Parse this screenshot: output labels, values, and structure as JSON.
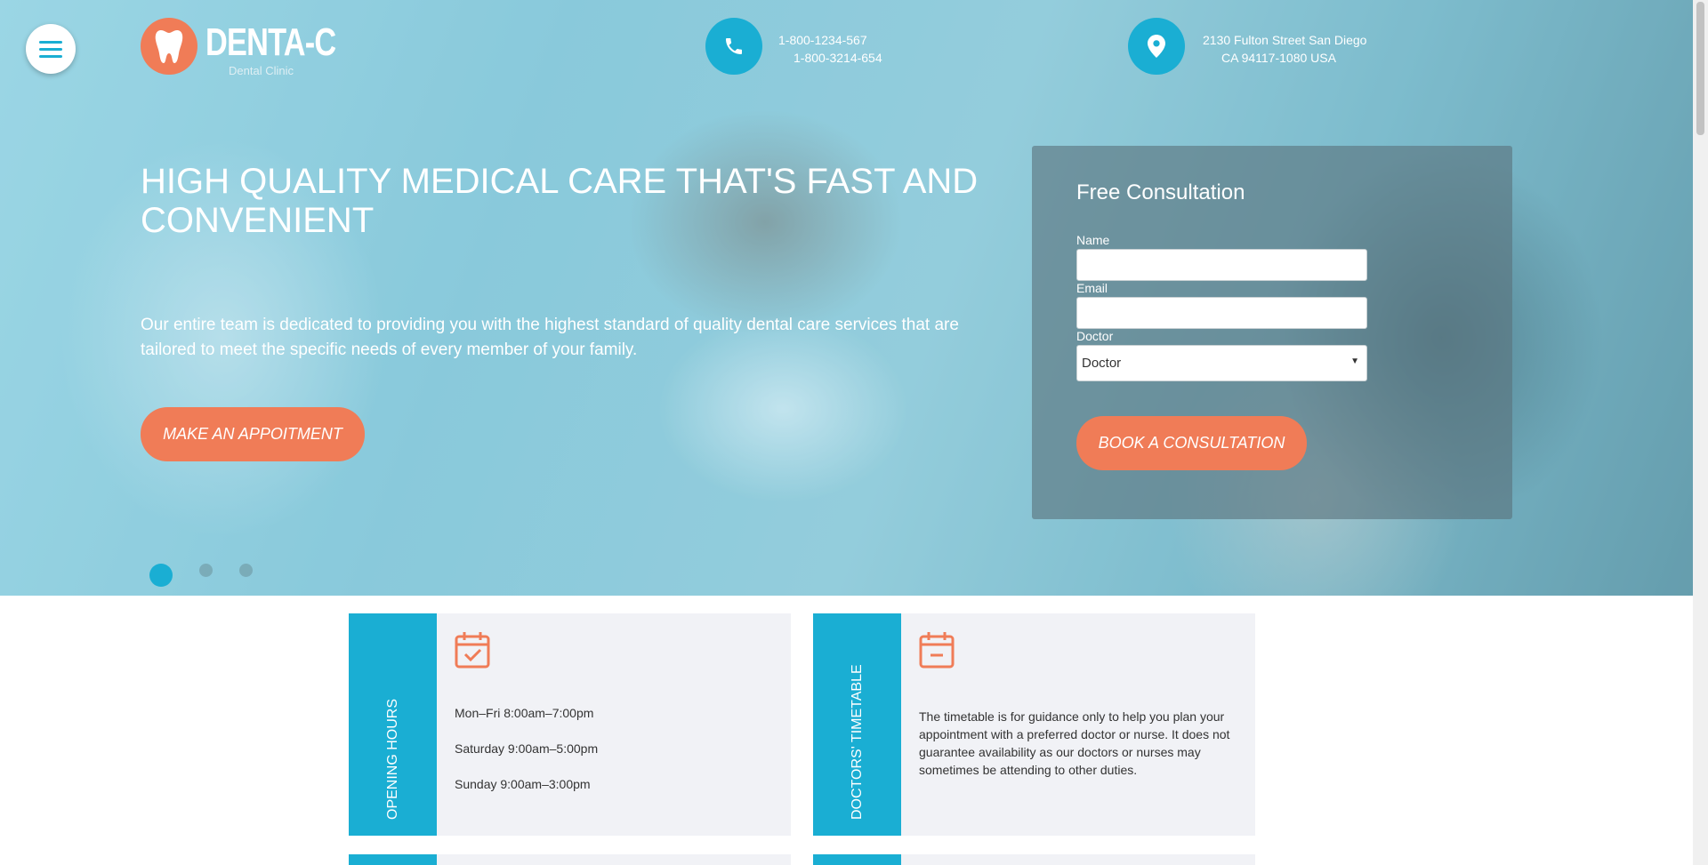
{
  "brand": {
    "name": "DENTA-C",
    "tagline": "Dental Clinic"
  },
  "contact": {
    "phones": [
      "1-800-1234-567",
      "1-800-3214-654"
    ],
    "address": [
      "2130 Fulton Street San Diego",
      "CA 94117-1080 USA"
    ]
  },
  "hero": {
    "title": "HIGH QUALITY MEDICAL CARE THAT'S FAST AND CONVENIENT",
    "description": "Our entire team is dedicated to providing you with the highest standard of quality dental care services that are tailored to meet the specific needs of every member of your family.",
    "cta_label": "MAKE AN APPOITMENT",
    "slides": {
      "count": 3,
      "active": 1
    }
  },
  "consultation": {
    "title": "Free Consultation",
    "name_label": "Name",
    "email_label": "Email",
    "doctor_label": "Doctor",
    "doctor_selected": "Doctor",
    "submit_label": "BOOK A CONSULTATION"
  },
  "cards": {
    "opening": {
      "title": "OPENING HOURS",
      "lines": [
        "Mon–Fri 8:00am–7:00pm",
        "Saturday 9:00am–5:00pm",
        "Sunday 9:00am–3:00pm"
      ]
    },
    "timetable": {
      "title": "DOCTORS' TIMETABLE",
      "text": "The timetable is for guidance only to help you plan your appointment with a preferred doctor or nurse. It does not guarantee availability as our doctors or nurses may sometimes be attending to other duties."
    }
  },
  "colors": {
    "accent": "#1aaed3",
    "orange": "#f07c57",
    "card_bg": "#f1f2f6"
  },
  "icons": [
    "menu-icon",
    "tooth-icon",
    "phone-icon",
    "location-pin-icon",
    "calendar-check-icon",
    "calendar-minus-icon"
  ]
}
